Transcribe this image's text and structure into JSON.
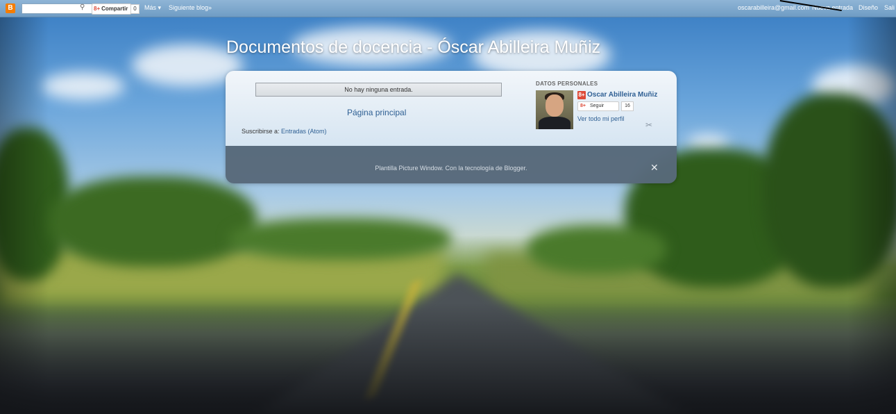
{
  "navbar": {
    "logo": "B",
    "search_value": "",
    "share_label": "Compartir",
    "gplus_mark": "8+",
    "share_count": "0",
    "more_label": "Más ▾",
    "next_blog": "Siguiente blog»",
    "email": "oscarabilleira@gmail.com",
    "new_post": "Nueva entrada",
    "design": "Diseño",
    "exit": "Sali"
  },
  "header": {
    "title": "Documentos de docencia - Óscar Abilleira Muñiz"
  },
  "main": {
    "no_entries": "No hay ninguna entrada.",
    "home_link": "Página principal",
    "subscribe_prefix": "Suscribirse a: ",
    "subscribe_link": "Entradas (Atom)"
  },
  "profile": {
    "section_title": "DATOS PERSONALES",
    "gplus_mark": "8+",
    "name": "Oscar Abilleira Muñiz",
    "follow_label": "Seguir",
    "follow_count": "16",
    "view_profile": "Ver todo mi perfil"
  },
  "footer": {
    "text": "Plantilla Picture Window. Con la tecnología de Blogger."
  },
  "icons": {
    "search": "⚲",
    "wrench": "✂",
    "wrench_footer": "✕"
  },
  "colors": {
    "navbar": "#7fa9cf",
    "link": "#2e5f93",
    "footer_bg": "#58697a",
    "blogger_orange": "#f57d00",
    "gplus_red": "#dd4b39"
  }
}
